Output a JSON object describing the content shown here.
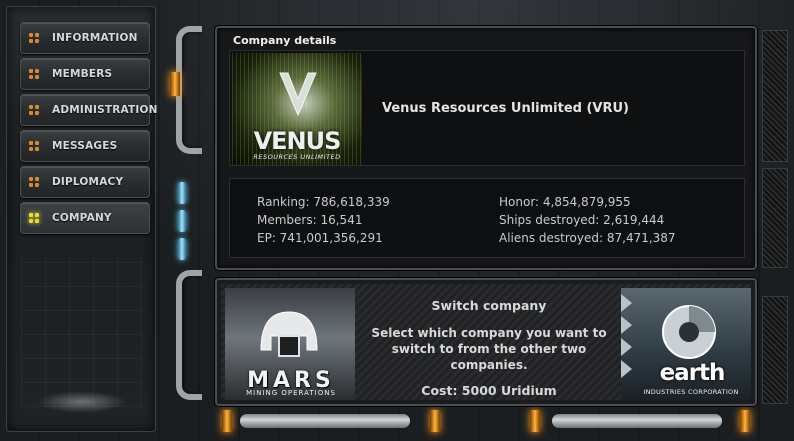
{
  "menu": {
    "items": [
      {
        "label": "INFORMATION",
        "active": false
      },
      {
        "label": "MEMBERS",
        "active": false
      },
      {
        "label": "ADMINISTRATION",
        "active": false
      },
      {
        "label": "MESSAGES",
        "active": false
      },
      {
        "label": "DIPLOMACY",
        "active": false
      },
      {
        "label": "COMPANY",
        "active": true
      }
    ]
  },
  "details": {
    "title": "Company details",
    "logo": {
      "word": "VENUS",
      "sub": "RESOURCES UNLIMITED"
    },
    "company_name": "Venus Resources Unlimited (VRU)",
    "stats_left": [
      "Ranking: 786,618,339",
      "Members: 16,541",
      "EP: 741,001,356,291"
    ],
    "stats_right": [
      "Honor: 4,854,879,955",
      "Ships destroyed: 2,619,444",
      "Aliens destroyed: 87,471,387"
    ]
  },
  "switch": {
    "heading": "Switch company",
    "description": "Select which company you want to switch to from the other two companies.",
    "cost": "Cost: 5000 Uridium",
    "mars": {
      "word": "MARS",
      "sub": "MINING OPERATIONS"
    },
    "earth": {
      "word": "earth",
      "sub": "INDUSTRIES CORPORATION"
    }
  },
  "colors": {
    "accent_amber": "#ffb53a",
    "accent_cyan": "#9fe4ff",
    "active_dot": "#e8e020"
  }
}
